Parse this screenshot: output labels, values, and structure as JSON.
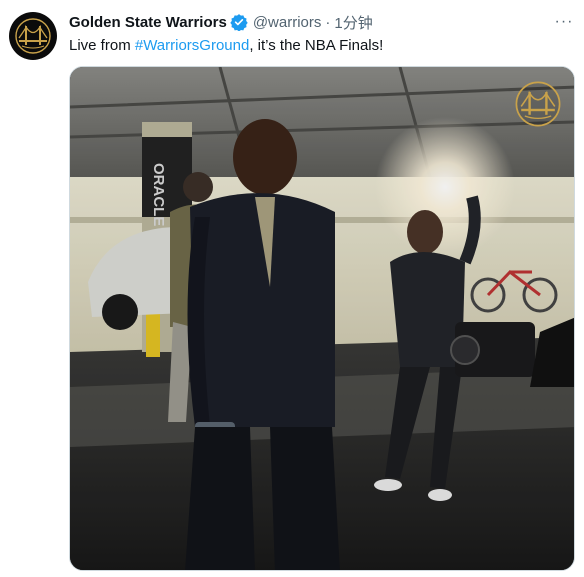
{
  "author": {
    "display_name": "Golden State Warriors",
    "handle": "@warriors",
    "separator": "·",
    "time": "1分钟",
    "avatar_icon": "warriors-bridge-logo-icon",
    "verified_icon": "verified-badge-icon"
  },
  "tweet": {
    "text_before": "Live from ",
    "hashtag": "#WarriorsGround",
    "text_after": ", it’s the NBA Finals!"
  },
  "media": {
    "type": "video",
    "watermark_icon": "warriors-bridge-logo-icon",
    "pillar_text": "ORACLE"
  },
  "actions": {
    "more_label": "···"
  },
  "colors": {
    "link": "#1d9bf0",
    "verified": "#1d9bf0",
    "secondary_text": "#536471",
    "warriors_gold": "#c9a24a"
  }
}
